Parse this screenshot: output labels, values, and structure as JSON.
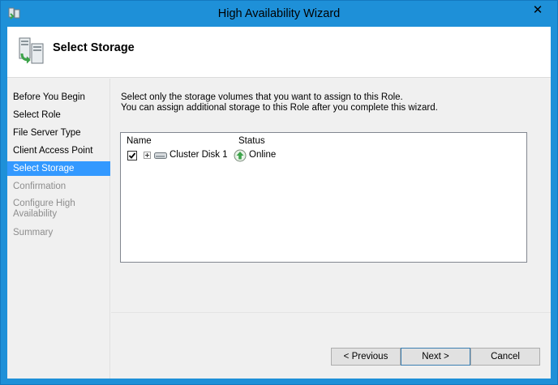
{
  "window": {
    "title": "High Availability Wizard"
  },
  "header": {
    "title": "Select Storage"
  },
  "sidebar": {
    "items": [
      {
        "label": "Before You Begin",
        "state": "normal"
      },
      {
        "label": "Select Role",
        "state": "normal"
      },
      {
        "label": "File Server Type",
        "state": "normal"
      },
      {
        "label": "Client Access Point",
        "state": "normal"
      },
      {
        "label": "Select Storage",
        "state": "active"
      },
      {
        "label": "Confirmation",
        "state": "disabled"
      },
      {
        "label": "Configure High Availability",
        "state": "disabled"
      },
      {
        "label": "Summary",
        "state": "disabled"
      }
    ]
  },
  "main": {
    "instruction_line1": "Select only the storage volumes that you want to assign to this Role.",
    "instruction_line2": "You can assign additional storage to this Role after you complete this wizard."
  },
  "storage_list": {
    "columns": {
      "name": "Name",
      "status": "Status"
    },
    "rows": [
      {
        "checked": true,
        "name": "Cluster Disk 1",
        "status": "Online"
      }
    ]
  },
  "buttons": {
    "previous": "< Previous",
    "next": "Next >",
    "cancel": "Cancel"
  },
  "colors": {
    "title_bar": "#1e90d8",
    "selection": "#3399ff",
    "online": "#3da34a"
  }
}
